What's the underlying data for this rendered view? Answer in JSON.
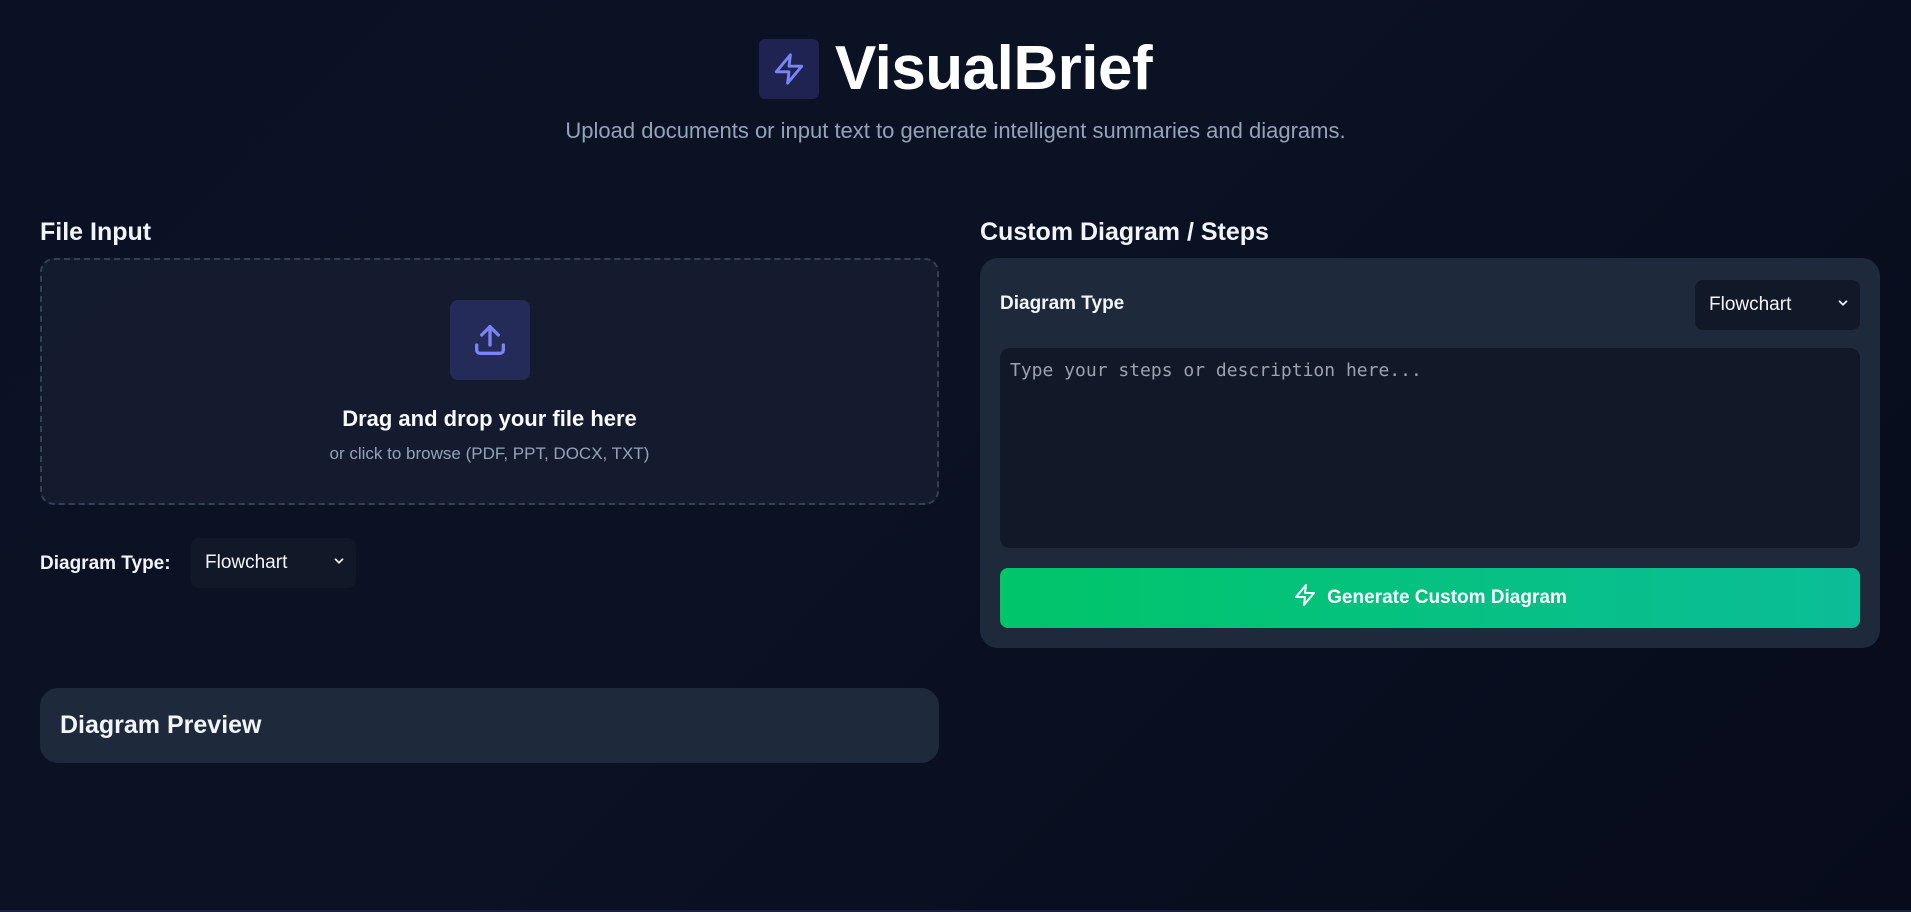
{
  "app": {
    "title": "VisualBrief",
    "subtitle": "Upload documents or input text to generate intelligent summaries and diagrams.",
    "logo_icon": "lightning-icon"
  },
  "file_input": {
    "heading": "File Input",
    "dropzone": {
      "icon": "upload-icon",
      "title": "Drag and drop your file here",
      "subtitle": "or click to browse (PDF, PPT, DOCX, TXT)"
    },
    "diagram_type_label": "Diagram Type:",
    "diagram_type_value": "Flowchart"
  },
  "preview": {
    "heading": "Diagram Preview"
  },
  "custom": {
    "heading": "Custom Diagram / Steps",
    "diagram_type_label": "Diagram Type",
    "diagram_type_value": "Flowchart",
    "textarea_placeholder": "Type your steps or description here...",
    "textarea_value": "",
    "button_label": "Generate Custom Diagram",
    "button_icon": "lightning-icon"
  },
  "colors": {
    "accent": "#6366f1",
    "button_start": "#00c569",
    "button_end": "#0bbd98",
    "background": "#0a1124",
    "card": "#1e293b"
  }
}
